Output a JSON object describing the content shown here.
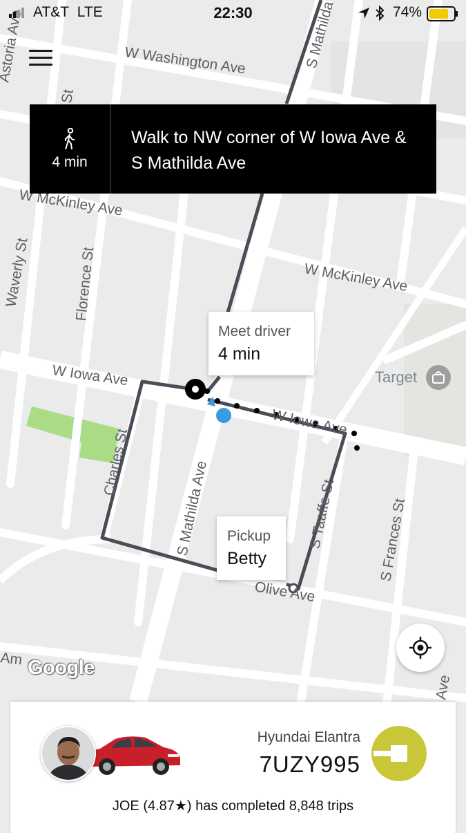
{
  "status_bar": {
    "carrier": "AT&T",
    "network": "LTE",
    "time": "22:30",
    "battery_percent": "74%"
  },
  "map": {
    "street_labels": {
      "w_washington": "W Washington Ave",
      "s_mathilda_top": "S Mathilda",
      "w_mckinley_left": "W McKinley Ave",
      "w_mckinley_right": "W McKinley Ave",
      "waverly": "Waverly St",
      "florence": "Florence St",
      "w_iowa_left": "W Iowa Ave",
      "w_iowa_right": "W Iowa Ave",
      "charles": "Charles St",
      "s_mathilda": "S Mathilda Ave",
      "s_taaffe": "S Taaffe St",
      "s_frances": "S Frances St",
      "olive": "Olive Ave",
      "ave_br": "Ave",
      "am_left": "Am",
      "st_top_left": "St",
      "astoria": "Astoria Ave"
    },
    "poi": {
      "target": "Target"
    },
    "google_logo": "Google"
  },
  "nav_banner": {
    "walk_time": "4 min",
    "instruction": "Walk to NW corner of W Iowa Ave & S Mathilda Ave"
  },
  "meet_driver": {
    "label": "Meet driver",
    "value": "4 min"
  },
  "pickup": {
    "label": "Pickup",
    "value": "Betty"
  },
  "driver_card": {
    "car_model": "Hyundai Elantra",
    "plate": "7UZY995",
    "driver_name": "JOE",
    "rating": "(4.87★)",
    "trips_text": "has completed 8,848 trips",
    "car_color": "#c8202a",
    "logo_color": "#c9c637"
  },
  "colors": {
    "route": "#4a4d55",
    "walk_dots": "#000000",
    "user_location": "#3b9be0",
    "park": "#a9dc84"
  }
}
